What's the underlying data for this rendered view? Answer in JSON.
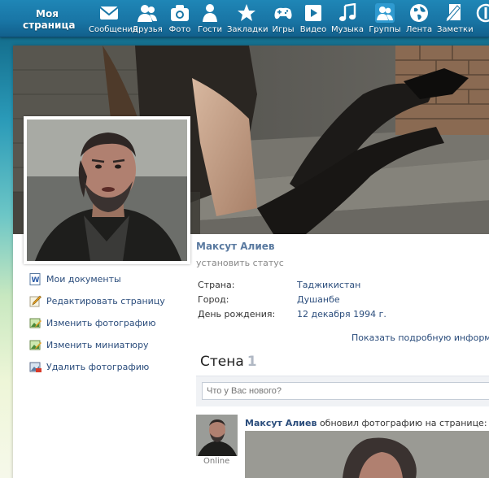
{
  "nav": {
    "my_page": "Моя страница",
    "items": [
      {
        "label": "Сообщения",
        "icon": "envelope-icon"
      },
      {
        "label": "Друзья",
        "icon": "friends-icon"
      },
      {
        "label": "Фото",
        "icon": "camera-icon"
      },
      {
        "label": "Гости",
        "icon": "guest-icon"
      },
      {
        "label": "Закладки",
        "icon": "star-icon"
      },
      {
        "label": "Игры",
        "icon": "gamepad-icon"
      },
      {
        "label": "Видео",
        "icon": "play-icon"
      },
      {
        "label": "Музыка",
        "icon": "music-icon"
      },
      {
        "label": "Группы",
        "icon": "groups-icon"
      },
      {
        "label": "Лента",
        "icon": "globe-icon"
      },
      {
        "label": "Заметки",
        "icon": "notes-icon"
      },
      {
        "label": "",
        "icon": "more-icon"
      }
    ]
  },
  "profile": {
    "name": "Максут Алиев",
    "status_placeholder": "установить статус",
    "info": [
      {
        "key": "Страна:",
        "value": "Таджикистан"
      },
      {
        "key": "Город:",
        "value": "Душанбе"
      },
      {
        "key": "День рождения:",
        "value": "12 декабря 1994 г."
      }
    ],
    "more_info": "Показать подробную информаци"
  },
  "actions": [
    {
      "label": "Мои документы",
      "icon": "document-icon"
    },
    {
      "label": "Редактировать страницу",
      "icon": "edit-icon"
    },
    {
      "label": "Изменить фотографию",
      "icon": "photo-edit-icon"
    },
    {
      "label": "Изменить миниатюру",
      "icon": "thumbnail-edit-icon"
    },
    {
      "label": "Удалить фотографию",
      "icon": "photo-delete-icon"
    }
  ],
  "wall": {
    "title": "Стена",
    "count": "1",
    "input_placeholder": "Что у Вас нового?",
    "post": {
      "author": "Максут Алиев",
      "action": "обновил фотографию на странице:",
      "online": "Online"
    }
  },
  "colors": {
    "nav_bg": "#1976a6",
    "link": "#2b4d7c",
    "name": "#5a7aa0",
    "muted": "#888888"
  }
}
